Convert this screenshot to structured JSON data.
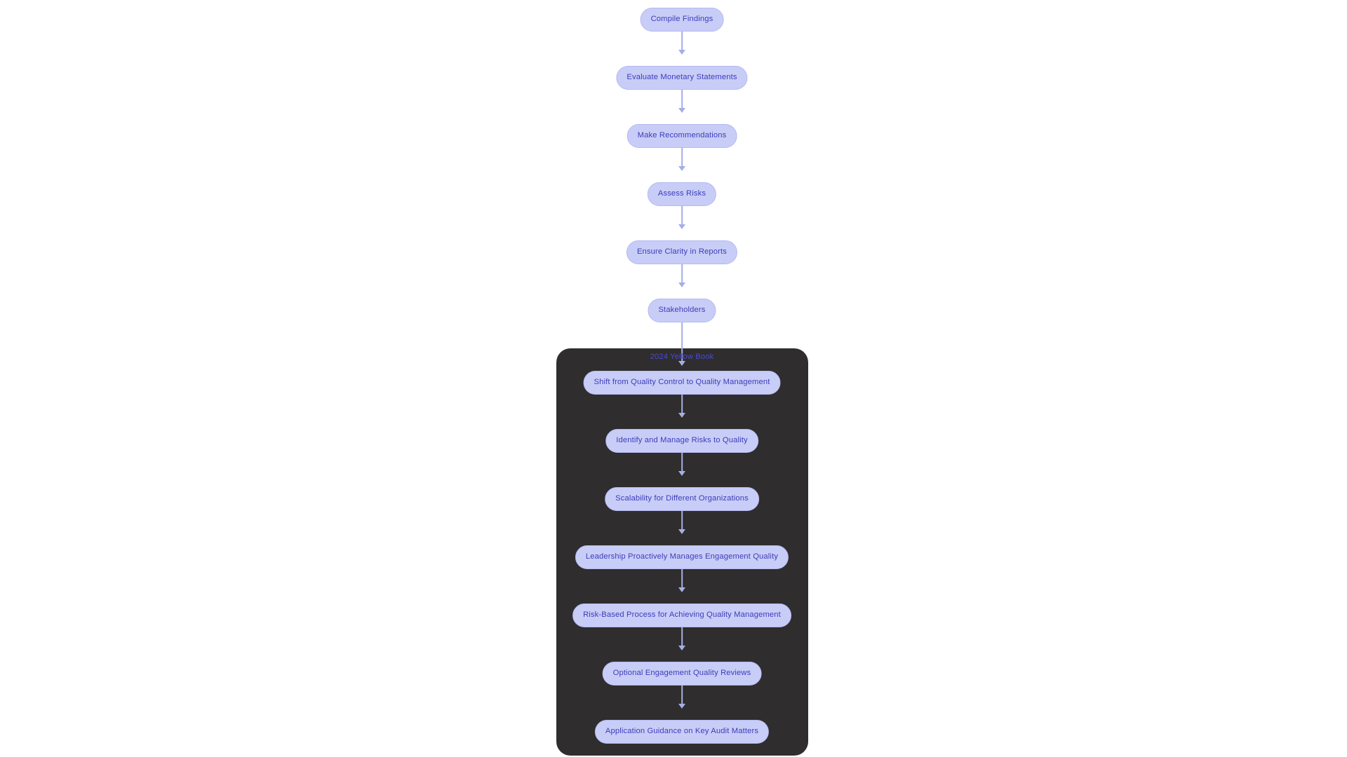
{
  "diagram": {
    "type": "flowchart",
    "direction": "top-to-bottom",
    "title": "",
    "background_color": "#ffffff",
    "node_fill_color": "#c8cdf8",
    "node_border_color": "#b3b9ef",
    "node_text_color": "#3c3cb8",
    "edge_color": "#a6aee6",
    "panel_background_color": "#2f2d2d"
  },
  "top_flow": {
    "nodes": [
      {
        "id": "n1",
        "label": "Compile Findings"
      },
      {
        "id": "n2",
        "label": "Evaluate Monetary Statements"
      },
      {
        "id": "n3",
        "label": "Make Recommendations"
      },
      {
        "id": "n4",
        "label": "Assess Risks"
      },
      {
        "id": "n5",
        "label": "Ensure Clarity in Reports"
      },
      {
        "id": "n6",
        "label": "Stakeholders"
      }
    ]
  },
  "transition_edge": {
    "label": "2024 Yellow Book",
    "from": "Stakeholders",
    "to": "Shift from Quality Control to Quality Management"
  },
  "panel_flow": {
    "nodes": [
      {
        "id": "p1",
        "label": "Shift from Quality Control to Quality Management"
      },
      {
        "id": "p2",
        "label": "Identify and Manage Risks to Quality"
      },
      {
        "id": "p3",
        "label": "Scalability for Different Organizations"
      },
      {
        "id": "p4",
        "label": "Leadership Proactively Manages Engagement Quality"
      },
      {
        "id": "p5",
        "label": "Risk-Based Process for Achieving Quality Management"
      },
      {
        "id": "p6",
        "label": "Optional Engagement Quality Reviews"
      },
      {
        "id": "p7",
        "label": "Application Guidance on Key Audit Matters"
      }
    ]
  }
}
